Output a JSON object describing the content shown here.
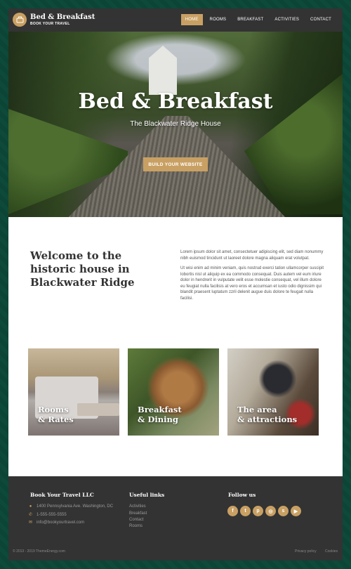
{
  "header": {
    "logo_title": "Bed & Breakfast",
    "logo_subtitle": "BOOK YOUR TRAVEL",
    "logo_icon": "suitcase-icon",
    "nav": [
      {
        "label": "HOME",
        "active": true
      },
      {
        "label": "ROOMS",
        "active": false
      },
      {
        "label": "BREAKFAST",
        "active": false
      },
      {
        "label": "ACTIVITIES",
        "active": false
      },
      {
        "label": "CONTACT",
        "active": false
      }
    ]
  },
  "hero": {
    "title": "Bed & Breakfast",
    "subtitle": "The Blackwater Ridge House",
    "button": "BUILD YOUR WEBSITE"
  },
  "welcome": {
    "heading": "Welcome to the historic house in Blackwater Ridge",
    "paragraph1": "Lorem ipsum dolor sit amet, consectetuer adipiscing elit, sed diam nonummy nibh euismod tincidunt ut laoreet dolore magna aliquam erat volutpat.",
    "paragraph2": "Ut wisi enim ad minim veniam, quis nostrud exerci tation ullamcorper suscipit lobortis nisl ut aliquip ex ea commodo consequat. Duis autem vel eum iriure dolor in hendrerit in vulputate velit esse molestie consequat, vel illum dolore eu feugiat nulla facilisis at vero eros et accumsan et iusto odio dignissim qui blandit praesent luptatum zzril delenit augue duis dolore te feugait nulla facilisi."
  },
  "tiles": [
    {
      "line1": "Rooms",
      "line2": "& Rates"
    },
    {
      "line1": "Breakfast",
      "line2": "& Dining"
    },
    {
      "line1": "The area",
      "line2": "& attractions"
    }
  ],
  "footer": {
    "company": {
      "title": "Book Your Travel LLC",
      "address": "1400 Pennsylvania Ave. Washington, DC",
      "phone": "1-555-555-5555",
      "email": "info@bookyourtravel.com"
    },
    "links": {
      "title": "Useful links",
      "items": [
        "Activities",
        "Breakfast",
        "Contact",
        "Rooms"
      ]
    },
    "follow": {
      "title": "Follow us",
      "icons": [
        "facebook-icon",
        "twitter-icon",
        "pinterest-icon",
        "instagram-icon",
        "skype-icon",
        "youtube-icon"
      ]
    },
    "copyright": "© 2013 - 2019 ThemeEnergy.com",
    "privacy": "Privacy policy",
    "cookies": "Cookies"
  },
  "colors": {
    "accent": "#c9a063",
    "dark": "#333333",
    "background": "#0d4a3a"
  }
}
